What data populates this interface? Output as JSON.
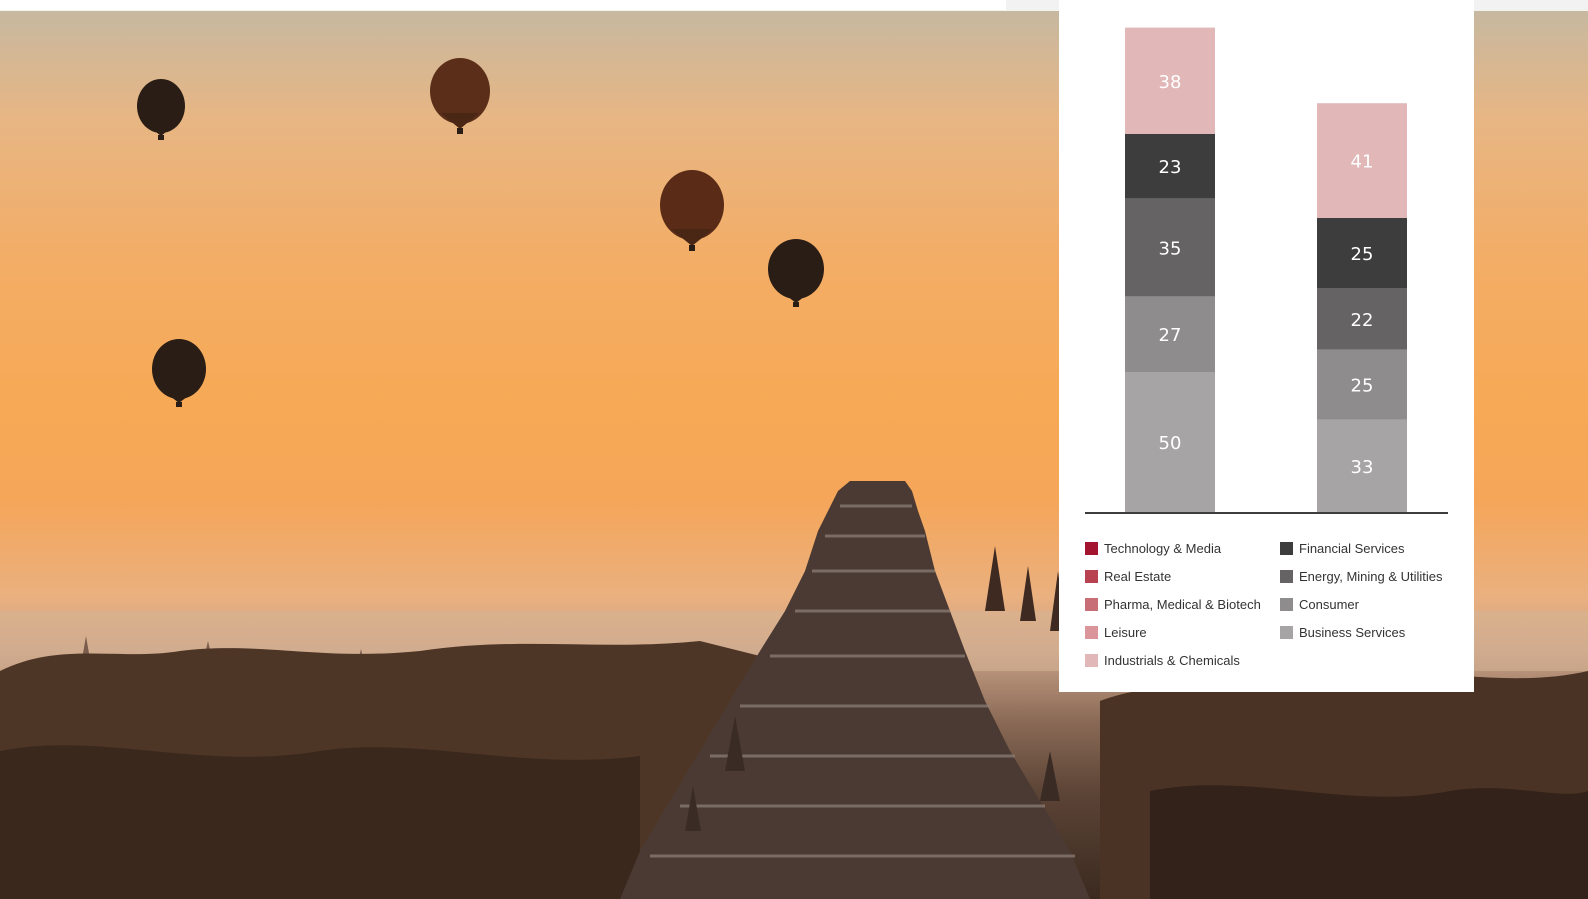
{
  "chart_data": {
    "type": "bar",
    "stacked": true,
    "categories": [
      "",
      ""
    ],
    "series": [
      {
        "name": "Business Services",
        "color": "#a6a4a4",
        "values": [
          50,
          33
        ]
      },
      {
        "name": "Consumer",
        "color": "#8e8c8c",
        "values": [
          27,
          25
        ]
      },
      {
        "name": "Energy, Mining & Utilities",
        "color": "#656363",
        "values": [
          35,
          22
        ]
      },
      {
        "name": "Financial Services",
        "color": "#3d3d3d",
        "values": [
          23,
          25
        ]
      },
      {
        "name": "Industrials & Chemicals",
        "color": "#e2b7b8",
        "values": [
          38,
          41
        ]
      }
    ],
    "legend": {
      "placement": "bottom",
      "columns": [
        [
          {
            "label": "Technology & Media",
            "color": "#a2142f"
          },
          {
            "label": "Real Estate",
            "color": "#b94250"
          },
          {
            "label": "Pharma, Medical & Biotech",
            "color": "#c76e76"
          },
          {
            "label": "Leisure",
            "color": "#d9959a"
          },
          {
            "label": "Industrials & Chemicals",
            "color": "#e2b7b8"
          }
        ],
        [
          {
            "label": "Financial Services",
            "color": "#3d3d3d"
          },
          {
            "label": "Energy, Mining & Utilities",
            "color": "#656363"
          },
          {
            "label": "Consumer",
            "color": "#8e8c8c"
          },
          {
            "label": "Business Services",
            "color": "#a6a4a4"
          }
        ]
      ]
    },
    "title": "",
    "xlabel": "",
    "ylabel": ""
  }
}
